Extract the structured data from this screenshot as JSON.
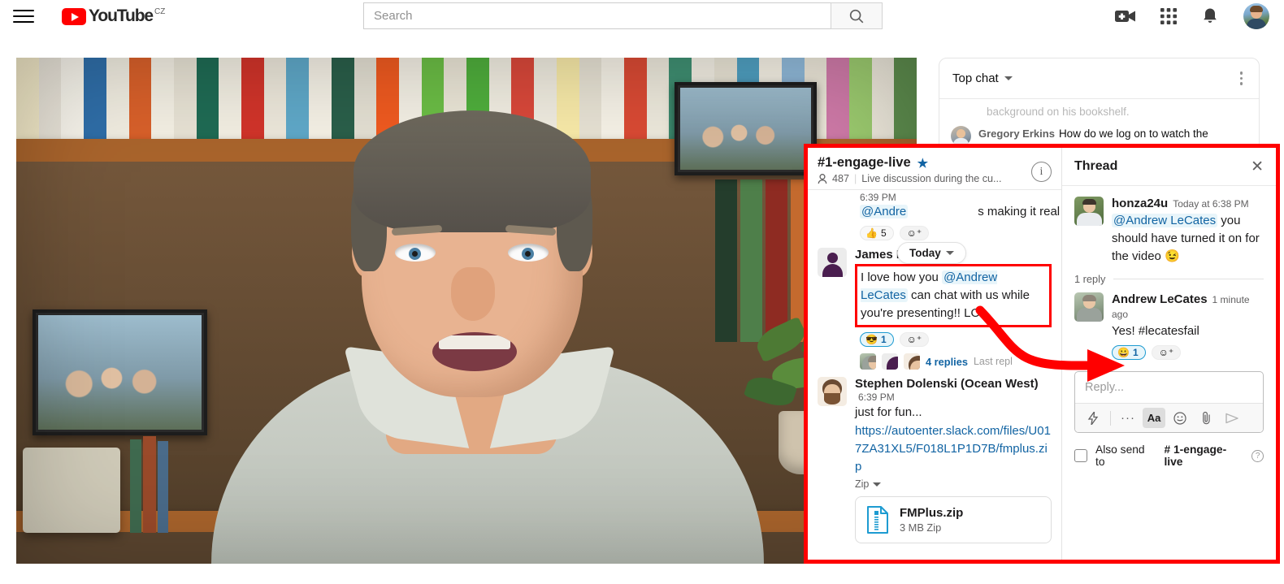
{
  "youtube": {
    "menu_icon": "hamburger-menu-icon",
    "logo_text": "YouTube",
    "logo_country": "CZ",
    "search": {
      "placeholder": "Search",
      "value": "",
      "button_icon": "search-icon"
    },
    "actions": [
      {
        "name": "create-video-icon",
        "label": ""
      },
      {
        "name": "apps-grid-icon",
        "label": ""
      },
      {
        "name": "notifications-bell-icon",
        "label": ""
      },
      {
        "name": "account-avatar",
        "label": ""
      }
    ],
    "chat": {
      "title": "Top chat",
      "menu_icon": "more-options-icon",
      "clipped_message": "background on his bookshelf.",
      "messages": [
        {
          "author": "Gregory Erkins",
          "text": "How do we log on to watch the presentations. WebEx asks for a URL and it is like NOWHERE!"
        }
      ]
    }
  },
  "slack": {
    "channel": {
      "name": "#1-engage-live",
      "starred": true,
      "star_icon": "star-icon",
      "members_icon": "members-icon",
      "members": "487",
      "topic": "Live discussion during the cu...",
      "info_icon": "info-icon",
      "date_divider": {
        "label": "Today",
        "caret_icon": "chevron-down-icon"
      },
      "partial_message": {
        "timestamp": "6:39 PM",
        "mention": "@Andre",
        "text_tail": "s making it real",
        "reactions": [
          {
            "emoji": "👍",
            "count": "5",
            "active": false
          }
        ],
        "add_reaction_icon": "add-reaction-icon"
      },
      "messages": [
        {
          "author": "James Hea",
          "timestamp": "6:39 PM",
          "avatar": "default-person-avatar",
          "highlighted": true,
          "text_parts": [
            {
              "type": "text",
              "value": "I love how you "
            },
            {
              "type": "mention",
              "value": "@Andrew LeCates"
            },
            {
              "type": "text",
              "value": " can chat with us while you're presenting!! LOL."
            }
          ],
          "reactions": [
            {
              "emoji": "😎",
              "count": "1",
              "active": true
            }
          ],
          "add_reaction_icon": "add-reaction-icon",
          "thread": {
            "replies_label": "4 replies",
            "last_reply_label": "Last repl"
          }
        },
        {
          "author": "Stephen Dolenski (Ocean West)",
          "timestamp": "6:39 PM",
          "avatar": "bitmoji-avatar",
          "highlighted": false,
          "text": "just for fun...",
          "link": "https://autoenter.slack.com/files/U017ZA31XL5/F018L1P1D7B/fmplus.zip",
          "filetype_label": "Zip",
          "filetype_caret": "chevron-down-icon",
          "attachment": {
            "icon": "zip-file-icon",
            "filename": "FMPlus.zip",
            "meta": "3 MB Zip"
          }
        }
      ]
    },
    "thread": {
      "title": "Thread",
      "close_icon": "close-icon",
      "root": {
        "author": "honza24u",
        "timestamp": "Today at 6:38 PM",
        "avatar": "photo-avatar-honza",
        "text_parts": [
          {
            "type": "mention",
            "value": "@Andrew LeCates"
          },
          {
            "type": "text",
            "value": " you should have turned it on for the video 😉"
          }
        ]
      },
      "reply_count_label": "1 reply",
      "replies": [
        {
          "author": "Andrew LeCates",
          "timestamp": "1 minute ago",
          "avatar": "photo-avatar-andrew",
          "text": "Yes! #lecatesfail",
          "reactions": [
            {
              "emoji": "😀",
              "count": "1",
              "active": true
            }
          ],
          "add_reaction_icon": "add-reaction-icon"
        }
      ],
      "composer": {
        "placeholder": "Reply...",
        "value": "",
        "buttons": [
          {
            "name": "shortcuts-lightning-icon",
            "glyph": "⚡",
            "active": false
          },
          {
            "name": "more-formatting-icon",
            "glyph": "···",
            "active": false
          },
          {
            "name": "text-formatting-icon",
            "glyph": "Aa",
            "active": true
          },
          {
            "name": "emoji-picker-icon",
            "glyph": "☺",
            "active": false
          },
          {
            "name": "attach-file-icon",
            "glyph": "📎",
            "active": false
          },
          {
            "name": "send-message-icon",
            "glyph": "➤",
            "active": false
          }
        ]
      },
      "also_send": {
        "checked": false,
        "label": "Also send to",
        "channel_hash": "#",
        "channel_name": "1-engage-live",
        "help_icon": "help-icon"
      }
    },
    "annotations": {
      "highlight_color": "#ff0000",
      "arrow_name": "red-annotation-arrow"
    }
  }
}
